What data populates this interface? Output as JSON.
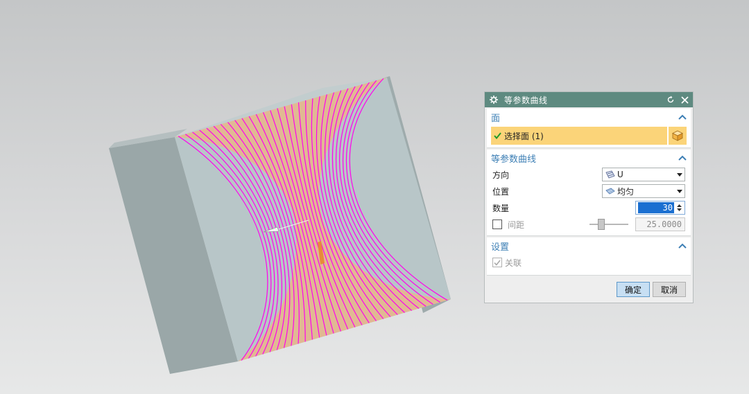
{
  "dialog": {
    "title": "等参数曲线",
    "icons": {
      "settings": "gear-icon",
      "reset": "reset-icon",
      "close": "close-icon"
    },
    "face_section": {
      "title": "面",
      "select_label": "选择面 (1)",
      "select_icon": "cube-icon"
    },
    "curve_section": {
      "title": "等参数曲线",
      "direction_label": "方向",
      "direction_value": "U",
      "position_label": "位置",
      "position_value": "均匀",
      "count_label": "数量",
      "count_value": "30",
      "spacing_label": "间距",
      "spacing_value": "25.0000"
    },
    "settings_section": {
      "title": "设置",
      "associative_label": "关联"
    },
    "ok_label": "确定",
    "cancel_label": "取消"
  },
  "colors": {
    "titlebar": "#5e8a80",
    "section_title": "#3d7fb5",
    "selection": "#fbd479",
    "isocurves": "#ff00ee",
    "model_body": "#a6b3b4"
  }
}
